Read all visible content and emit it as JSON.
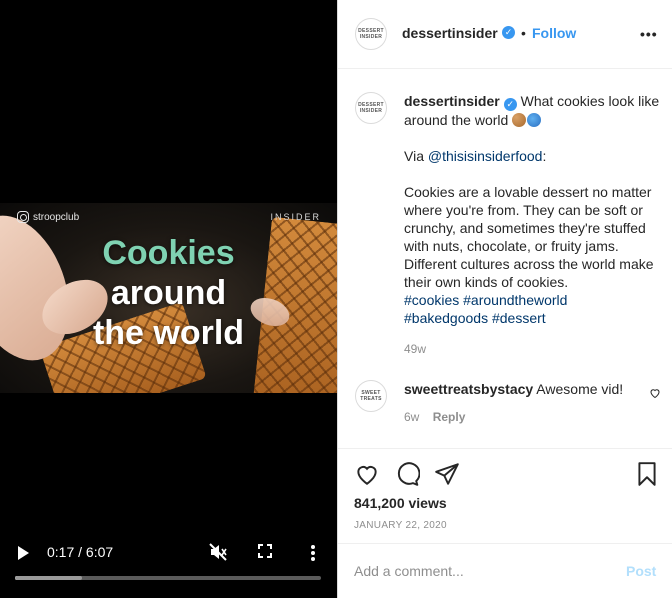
{
  "video": {
    "watermark_handle": "stroopclub",
    "brand_mark": "INSIDER",
    "headline": {
      "line1": "Cookies",
      "line2": "around",
      "line3": "the world"
    },
    "time_display": "0:17 / 6:07",
    "progress_fraction": 0.046,
    "buffered_fraction": 0.22
  },
  "header": {
    "avatar_text": "DESSERT INSIDER",
    "username": "dessertinsider",
    "separator": "•",
    "follow_label": "Follow",
    "more_label": "•••"
  },
  "caption": {
    "username": "dessertinsider",
    "line_lead": " What cookies look like around the world ",
    "via_prefix": "Via ",
    "via_handle": "@thisisinsiderfood",
    "via_suffix": ":",
    "body": "Cookies are a lovable dessert no matter where you're from. They can be soft or crunchy, and sometimes they're stuffed with nuts, chocolate, or fruity jams. Different cultures across the world make their own kinds of cookies.",
    "hashtags_1": "#cookies #aroundtheworld",
    "hashtags_2": "#bakedgoods #dessert",
    "age": "49w"
  },
  "comment": {
    "avatar_text": "SWEET TREATS",
    "username": "sweettreatsbystacy",
    "text": " Awesome vid!",
    "age": "6w",
    "reply_label": "Reply"
  },
  "stats": {
    "views": "841,200 views",
    "date": "JANUARY 22, 2020"
  },
  "compose": {
    "placeholder": "Add a comment...",
    "post_label": "Post"
  },
  "colors": {
    "accent": "#3897f0",
    "headline_green": "#7fd2b2",
    "post_disabled": "#b2dffc"
  },
  "icons": {
    "play": "play-icon",
    "mute": "muted-speaker-icon",
    "fullscreen": "fullscreen-icon",
    "more_vertical": "more-vertical-icon",
    "like": "heart-icon",
    "comment": "comment-bubble-icon",
    "share": "paper-plane-icon",
    "save": "bookmark-icon"
  }
}
